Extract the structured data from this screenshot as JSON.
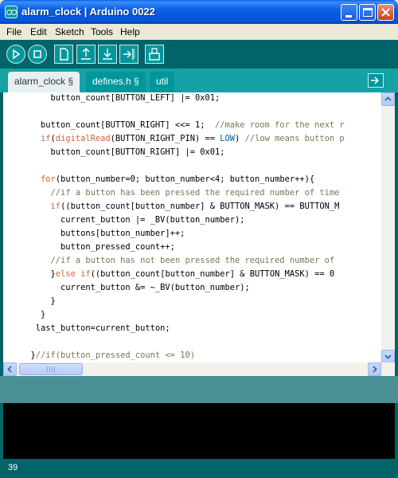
{
  "window": {
    "title": "alarm_clock | Arduino 0022",
    "accent_color": "#0a5fe8"
  },
  "menu": {
    "items": [
      "File",
      "Edit",
      "Sketch",
      "Tools",
      "Help"
    ]
  },
  "toolbar": {
    "buttons": [
      "verify-icon",
      "stop-icon",
      "new-icon",
      "open-icon",
      "save-icon",
      "upload-icon",
      "serial-monitor-icon"
    ],
    "color": "#006468"
  },
  "tabs": [
    {
      "label": "alarm_clock §",
      "active": true
    },
    {
      "label": "defines.h §",
      "active": false
    },
    {
      "label": "util",
      "active": false
    }
  ],
  "editor": {
    "lines": [
      {
        "indent": "      ",
        "segments": [
          {
            "t": "button_count[BUTTON_LEFT] |= 0x01;",
            "c": ""
          }
        ]
      },
      {
        "indent": "",
        "segments": []
      },
      {
        "indent": "    ",
        "segments": [
          {
            "t": "button_count[BUTTON_RIGHT] <<= 1;  ",
            "c": ""
          },
          {
            "t": "//make room for the next r",
            "c": "cmt"
          }
        ]
      },
      {
        "indent": "    ",
        "segments": [
          {
            "t": "if",
            "c": "kw"
          },
          {
            "t": "(",
            "c": ""
          },
          {
            "t": "digitalRead",
            "c": "kw"
          },
          {
            "t": "(BUTTON_RIGHT_PIN) == ",
            "c": ""
          },
          {
            "t": "LOW",
            "c": "const"
          },
          {
            "t": ") ",
            "c": ""
          },
          {
            "t": "//low means button p",
            "c": "cmt"
          }
        ]
      },
      {
        "indent": "      ",
        "segments": [
          {
            "t": "button_count[BUTTON_RIGHT] |= 0x01;",
            "c": ""
          }
        ]
      },
      {
        "indent": "",
        "segments": []
      },
      {
        "indent": "    ",
        "segments": [
          {
            "t": "for",
            "c": "kw"
          },
          {
            "t": "(button_number=0; button_number<4; button_number++){",
            "c": ""
          }
        ]
      },
      {
        "indent": "      ",
        "segments": [
          {
            "t": "//if a button has been pressed the required number of time",
            "c": "cmt"
          }
        ]
      },
      {
        "indent": "      ",
        "segments": [
          {
            "t": "if",
            "c": "kw"
          },
          {
            "t": "((button_count[button_number] & BUTTON_MASK) == BUTTON_M",
            "c": ""
          }
        ]
      },
      {
        "indent": "        ",
        "segments": [
          {
            "t": "current_button |= _BV(button_number);",
            "c": ""
          }
        ]
      },
      {
        "indent": "        ",
        "segments": [
          {
            "t": "buttons[button_number]++;",
            "c": ""
          }
        ]
      },
      {
        "indent": "        ",
        "segments": [
          {
            "t": "button_pressed_count++;",
            "c": ""
          }
        ]
      },
      {
        "indent": "      ",
        "segments": [
          {
            "t": "//if a button has not been pressed the required number of",
            "c": "cmt"
          }
        ]
      },
      {
        "indent": "      ",
        "segments": [
          {
            "t": "}",
            "c": ""
          },
          {
            "t": "else if",
            "c": "kw"
          },
          {
            "t": "((button_count[button_number] & BUTTON_MASK) == 0",
            "c": ""
          }
        ]
      },
      {
        "indent": "        ",
        "segments": [
          {
            "t": "current_button &= ~_BV(button_number);",
            "c": ""
          }
        ]
      },
      {
        "indent": "      ",
        "segments": [
          {
            "t": "}",
            "c": ""
          }
        ]
      },
      {
        "indent": "    ",
        "segments": [
          {
            "t": "}",
            "c": ""
          }
        ]
      },
      {
        "indent": "   ",
        "segments": [
          {
            "t": "last_button=current_button;",
            "c": ""
          }
        ]
      },
      {
        "indent": "",
        "segments": []
      },
      {
        "indent": "  ",
        "segments": [
          {
            "t": "}",
            "c": ""
          },
          {
            "t": "//if(button_pressed_count <= 10)",
            "c": "cmt"
          }
        ]
      }
    ]
  },
  "status": {
    "line_number": "39"
  }
}
